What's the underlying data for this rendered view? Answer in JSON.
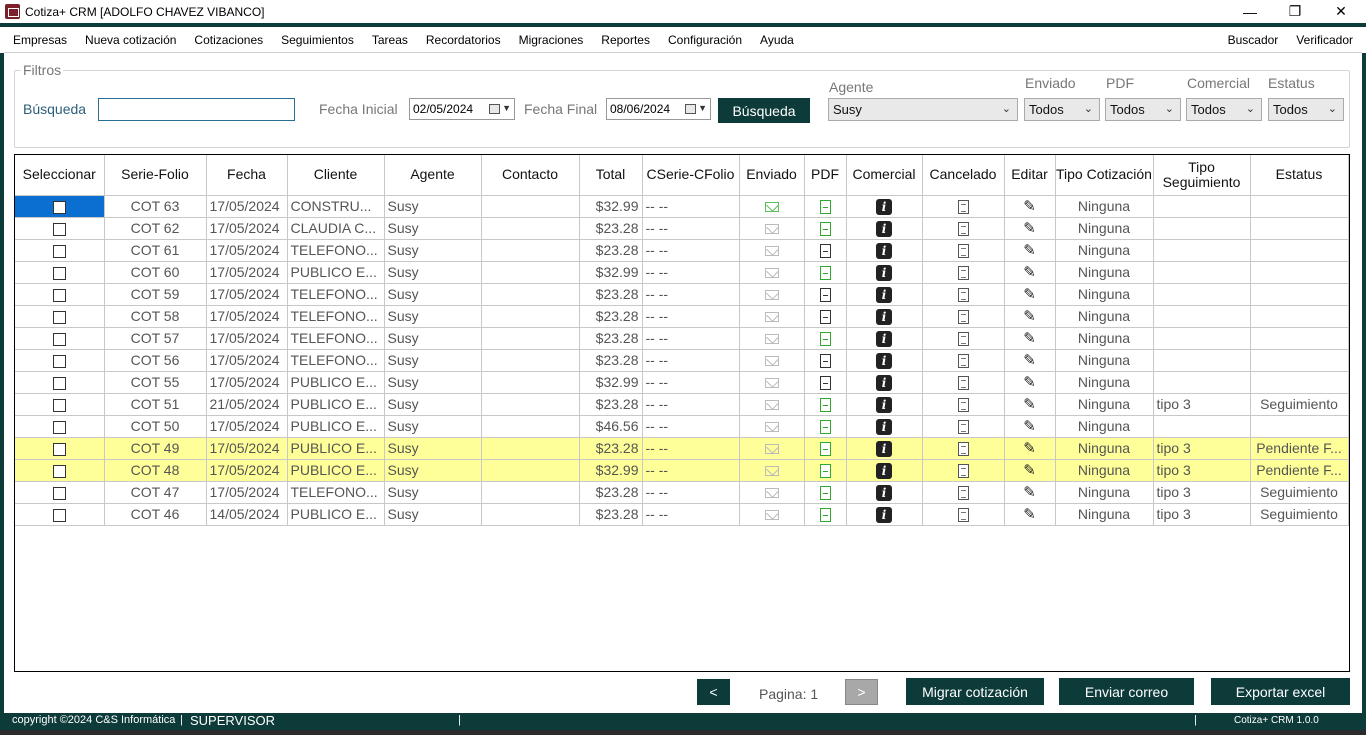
{
  "window": {
    "title": "Cotiza+ CRM [ADOLFO CHAVEZ VIBANCO]",
    "controls": {
      "minimize": "—",
      "restore": "❐",
      "close": "✕"
    }
  },
  "menu": {
    "left": [
      "Empresas",
      "Nueva cotización",
      "Cotizaciones",
      "Seguimientos",
      "Tareas",
      "Recordatorios",
      "Migraciones",
      "Reportes",
      "Configuración",
      "Ayuda"
    ],
    "right": [
      "Buscador",
      "Verificador"
    ]
  },
  "filters": {
    "legend": "Filtros",
    "search_label": "Búsqueda",
    "search_value": "",
    "fecha_inicial_label": "Fecha Inicial",
    "fecha_inicial": "02/05/2024",
    "fecha_final_label": "Fecha Final",
    "fecha_final": "08/06/2024",
    "search_button": "Búsqueda",
    "agente_label": "Agente",
    "agente_value": "Susy",
    "enviado_label": "Enviado",
    "enviado_value": "Todos",
    "pdf_label": "PDF",
    "pdf_value": "Todos",
    "comercial_label": "Comercial",
    "comercial_value": "Todos",
    "estatus_label": "Estatus",
    "estatus_value": "Todos"
  },
  "table": {
    "headers": [
      "Seleccionar",
      "Serie-Folio",
      "Fecha",
      "Cliente",
      "Agente",
      "Contacto",
      "Total",
      "CSerie-CFolio",
      "Enviado",
      "PDF",
      "Comercial",
      "Cancelado",
      "Editar",
      "Tipo Cotización",
      "Tipo Seguimiento",
      "Estatus"
    ],
    "rows": [
      {
        "folio": "COT 63",
        "fecha": "17/05/2024",
        "cliente": "CONSTRU...",
        "agente": "Susy",
        "contacto": "",
        "total": "$32.99",
        "cfolio": "-- --",
        "enviado": true,
        "pdf": "green",
        "tipo_cot": "Ninguna",
        "tipo_seg": "",
        "estatus": "",
        "highlight": false,
        "selected_cell": true
      },
      {
        "folio": "COT 62",
        "fecha": "17/05/2024",
        "cliente": "CLAUDIA C...",
        "agente": "Susy",
        "contacto": "",
        "total": "$23.28",
        "cfolio": "-- --",
        "enviado": false,
        "pdf": "green",
        "tipo_cot": "Ninguna",
        "tipo_seg": "",
        "estatus": "",
        "highlight": false
      },
      {
        "folio": "COT 61",
        "fecha": "17/05/2024",
        "cliente": "TELEFONO...",
        "agente": "Susy",
        "contacto": "",
        "total": "$23.28",
        "cfolio": "-- --",
        "enviado": false,
        "pdf": "black",
        "tipo_cot": "Ninguna",
        "tipo_seg": "",
        "estatus": "",
        "highlight": false
      },
      {
        "folio": "COT 60",
        "fecha": "17/05/2024",
        "cliente": "PUBLICO E...",
        "agente": "Susy",
        "contacto": "",
        "total": "$32.99",
        "cfolio": "-- --",
        "enviado": false,
        "pdf": "green",
        "tipo_cot": "Ninguna",
        "tipo_seg": "",
        "estatus": "",
        "highlight": false
      },
      {
        "folio": "COT 59",
        "fecha": "17/05/2024",
        "cliente": "TELEFONO...",
        "agente": "Susy",
        "contacto": "",
        "total": "$23.28",
        "cfolio": "-- --",
        "enviado": false,
        "pdf": "black",
        "tipo_cot": "Ninguna",
        "tipo_seg": "",
        "estatus": "",
        "highlight": false
      },
      {
        "folio": "COT 58",
        "fecha": "17/05/2024",
        "cliente": "TELEFONO...",
        "agente": "Susy",
        "contacto": "",
        "total": "$23.28",
        "cfolio": "-- --",
        "enviado": false,
        "pdf": "black",
        "tipo_cot": "Ninguna",
        "tipo_seg": "",
        "estatus": "",
        "highlight": false
      },
      {
        "folio": "COT 57",
        "fecha": "17/05/2024",
        "cliente": "TELEFONO...",
        "agente": "Susy",
        "contacto": "",
        "total": "$23.28",
        "cfolio": "-- --",
        "enviado": false,
        "pdf": "green",
        "tipo_cot": "Ninguna",
        "tipo_seg": "",
        "estatus": "",
        "highlight": false
      },
      {
        "folio": "COT 56",
        "fecha": "17/05/2024",
        "cliente": "TELEFONO...",
        "agente": "Susy",
        "contacto": "",
        "total": "$23.28",
        "cfolio": "-- --",
        "enviado": false,
        "pdf": "black",
        "tipo_cot": "Ninguna",
        "tipo_seg": "",
        "estatus": "",
        "highlight": false
      },
      {
        "folio": "COT 55",
        "fecha": "17/05/2024",
        "cliente": "PUBLICO E...",
        "agente": "Susy",
        "contacto": "",
        "total": "$32.99",
        "cfolio": "-- --",
        "enviado": false,
        "pdf": "black",
        "tipo_cot": "Ninguna",
        "tipo_seg": "",
        "estatus": "",
        "highlight": false
      },
      {
        "folio": "COT 51",
        "fecha": "21/05/2024",
        "cliente": "PUBLICO E...",
        "agente": "Susy",
        "contacto": "",
        "total": "$23.28",
        "cfolio": "-- --",
        "enviado": false,
        "pdf": "green",
        "tipo_cot": "Ninguna",
        "tipo_seg": "tipo 3",
        "estatus": "Seguimiento",
        "highlight": false
      },
      {
        "folio": "COT 50",
        "fecha": "17/05/2024",
        "cliente": "PUBLICO E...",
        "agente": "Susy",
        "contacto": "",
        "total": "$46.56",
        "cfolio": "-- --",
        "enviado": false,
        "pdf": "green",
        "tipo_cot": "Ninguna",
        "tipo_seg": "",
        "estatus": "",
        "highlight": false
      },
      {
        "folio": "COT 49",
        "fecha": "17/05/2024",
        "cliente": "PUBLICO E...",
        "agente": "Susy",
        "contacto": "",
        "total": "$23.28",
        "cfolio": "-- --",
        "enviado": false,
        "pdf": "green",
        "tipo_cot": "Ninguna",
        "tipo_seg": "tipo 3",
        "estatus": "Pendiente F...",
        "highlight": true
      },
      {
        "folio": "COT 48",
        "fecha": "17/05/2024",
        "cliente": "PUBLICO E...",
        "agente": "Susy",
        "contacto": "",
        "total": "$32.99",
        "cfolio": "-- --",
        "enviado": false,
        "pdf": "green",
        "tipo_cot": "Ninguna",
        "tipo_seg": "tipo 3",
        "estatus": "Pendiente F...",
        "highlight": true
      },
      {
        "folio": "COT 47",
        "fecha": "17/05/2024",
        "cliente": "TELEFONO...",
        "agente": "Susy",
        "contacto": "",
        "total": "$23.28",
        "cfolio": "-- --",
        "enviado": false,
        "pdf": "green",
        "tipo_cot": "Ninguna",
        "tipo_seg": "tipo 3",
        "estatus": "Seguimiento",
        "highlight": false
      },
      {
        "folio": "COT 46",
        "fecha": "14/05/2024",
        "cliente": "PUBLICO E...",
        "agente": "Susy",
        "contacto": "",
        "total": "$23.28",
        "cfolio": "-- --",
        "enviado": false,
        "pdf": "green",
        "tipo_cot": "Ninguna",
        "tipo_seg": "tipo 3",
        "estatus": "Seguimiento",
        "highlight": false
      }
    ]
  },
  "pagination": {
    "prev": "<",
    "next": ">",
    "label": "Pagina: 1"
  },
  "actions": {
    "migrar": "Migrar cotización",
    "enviar": "Enviar correo",
    "exportar": "Exportar excel"
  },
  "status": {
    "copyright": "copyright ©2024 C&S Informática",
    "role": "SUPERVISOR",
    "version": "Cotiza+ CRM 1.0.0"
  },
  "colors": {
    "accent": "#0d3b3a",
    "highlight_row": "#ffff99",
    "selected_cell": "#0a6fd1"
  }
}
